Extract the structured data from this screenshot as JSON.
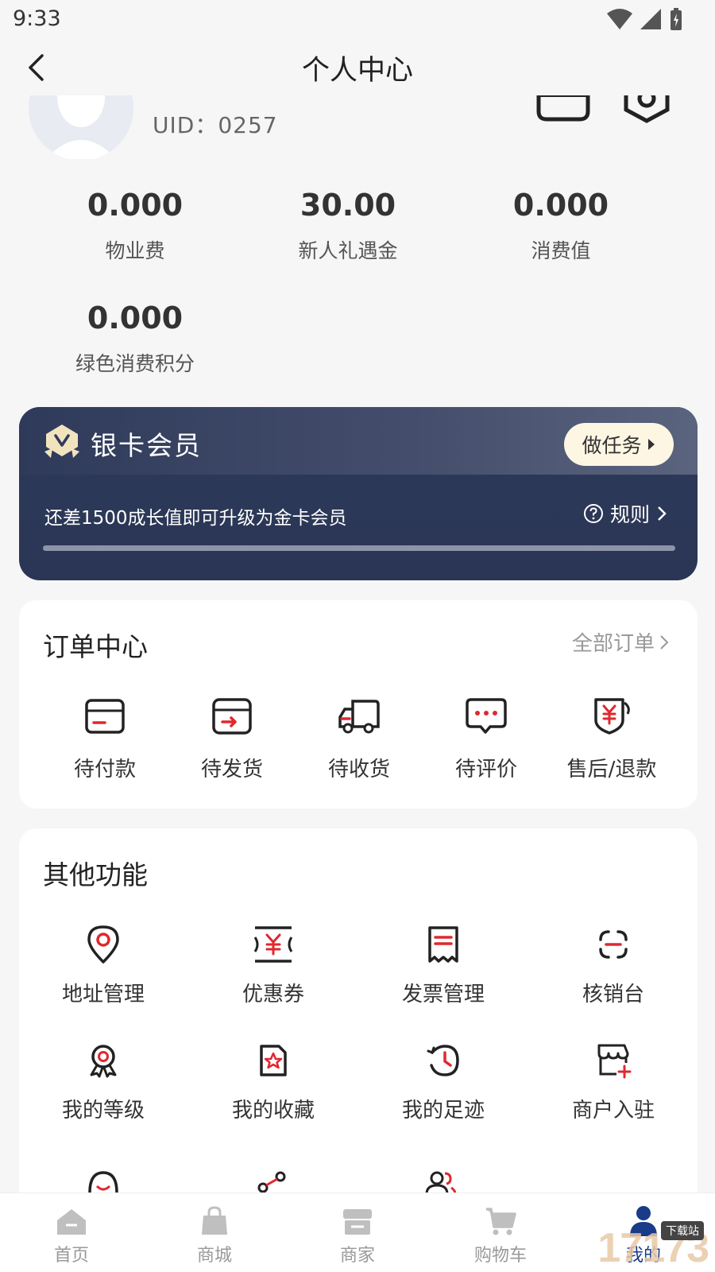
{
  "status": {
    "time": "9:33"
  },
  "header": {
    "title": "个人中心"
  },
  "profile": {
    "uid": "UID：0257"
  },
  "stats": [
    {
      "value": "0.000",
      "label": "物业费"
    },
    {
      "value": "30.00",
      "label": "新人礼遇金"
    },
    {
      "value": "0.000",
      "label": "消费值"
    },
    {
      "value": "0.000",
      "label": "绿色消费积分"
    }
  ],
  "member": {
    "title": "银卡会员",
    "task_label": "做任务",
    "description": "还差1500成长值即可升级为金卡会员",
    "rules_label": "规则",
    "progress": 0
  },
  "orders": {
    "title": "订单中心",
    "all_label": "全部订单",
    "items": [
      {
        "label": "待付款",
        "icon": "wallet-icon"
      },
      {
        "label": "待发货",
        "icon": "box-arrow-icon"
      },
      {
        "label": "待收货",
        "icon": "truck-icon"
      },
      {
        "label": "待评价",
        "icon": "chat-dots-icon"
      },
      {
        "label": "售后/退款",
        "icon": "yuan-shield-icon"
      }
    ]
  },
  "functions": {
    "title": "其他功能",
    "items": [
      {
        "label": "地址管理",
        "icon": "location-pin-icon"
      },
      {
        "label": "优惠券",
        "icon": "coupon-icon"
      },
      {
        "label": "发票管理",
        "icon": "receipt-icon"
      },
      {
        "label": "核销台",
        "icon": "scan-icon"
      },
      {
        "label": "我的等级",
        "icon": "medal-icon"
      },
      {
        "label": "我的收藏",
        "icon": "star-doc-icon"
      },
      {
        "label": "我的足迹",
        "icon": "history-clock-icon"
      },
      {
        "label": "商户入驻",
        "icon": "store-plus-icon"
      }
    ]
  },
  "tabbar": [
    {
      "label": "首页",
      "icon": "home-icon"
    },
    {
      "label": "商城",
      "icon": "shopping-bag-icon"
    },
    {
      "label": "商家",
      "icon": "shop-icon"
    },
    {
      "label": "购物车",
      "icon": "cart-icon"
    },
    {
      "label": "我的",
      "icon": "user-icon",
      "active": true
    }
  ],
  "watermark": {
    "text": "17173",
    "tag": "下载站"
  },
  "colors": {
    "accent_red": "#e0282f",
    "member_card": "#2d3a59",
    "active_tab": "#1a3a8a"
  }
}
